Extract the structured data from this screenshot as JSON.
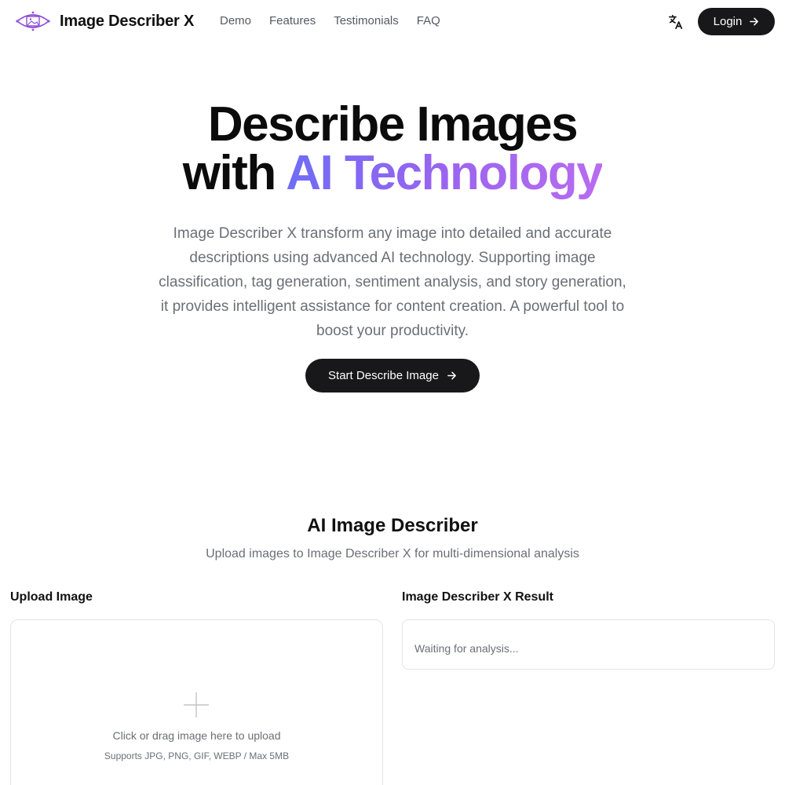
{
  "header": {
    "brand": "Image Describer X",
    "nav": [
      {
        "label": "Demo"
      },
      {
        "label": "Features"
      },
      {
        "label": "Testimonials"
      },
      {
        "label": "FAQ"
      }
    ],
    "login_label": "Login",
    "icons": {
      "logo": "eye-image-logo-icon",
      "language": "translate-icon",
      "arrow": "arrow-right-icon"
    }
  },
  "hero": {
    "title_line1": "Describe Images",
    "title_line2_plain": "with",
    "title_line2_gradient": "AI Technology",
    "description": "Image Describer X transform any image into detailed and accurate descriptions using advanced AI technology. Supporting image classification, tag generation, sentiment analysis, and story generation, it provides intelligent assistance for content creation. A powerful tool to boost your productivity.",
    "cta_label": "Start Describe Image"
  },
  "describer": {
    "title": "AI Image Describer",
    "subtitle": "Upload images to Image Describer X for multi-dimensional analysis",
    "upload_label": "Upload Image",
    "upload_prompt": "Click or drag image here to upload",
    "upload_note": "Supports JPG, PNG, GIF, WEBP / Max 5MB",
    "result_label": "Image Describer X Result",
    "result_placeholder": "Waiting for analysis..."
  },
  "colors": {
    "primary_button": "#18181b",
    "gradient_start": "#6f6cf6",
    "gradient_end": "#b86cf0",
    "muted_text": "#6b6f76",
    "border": "#e4e4e7"
  }
}
